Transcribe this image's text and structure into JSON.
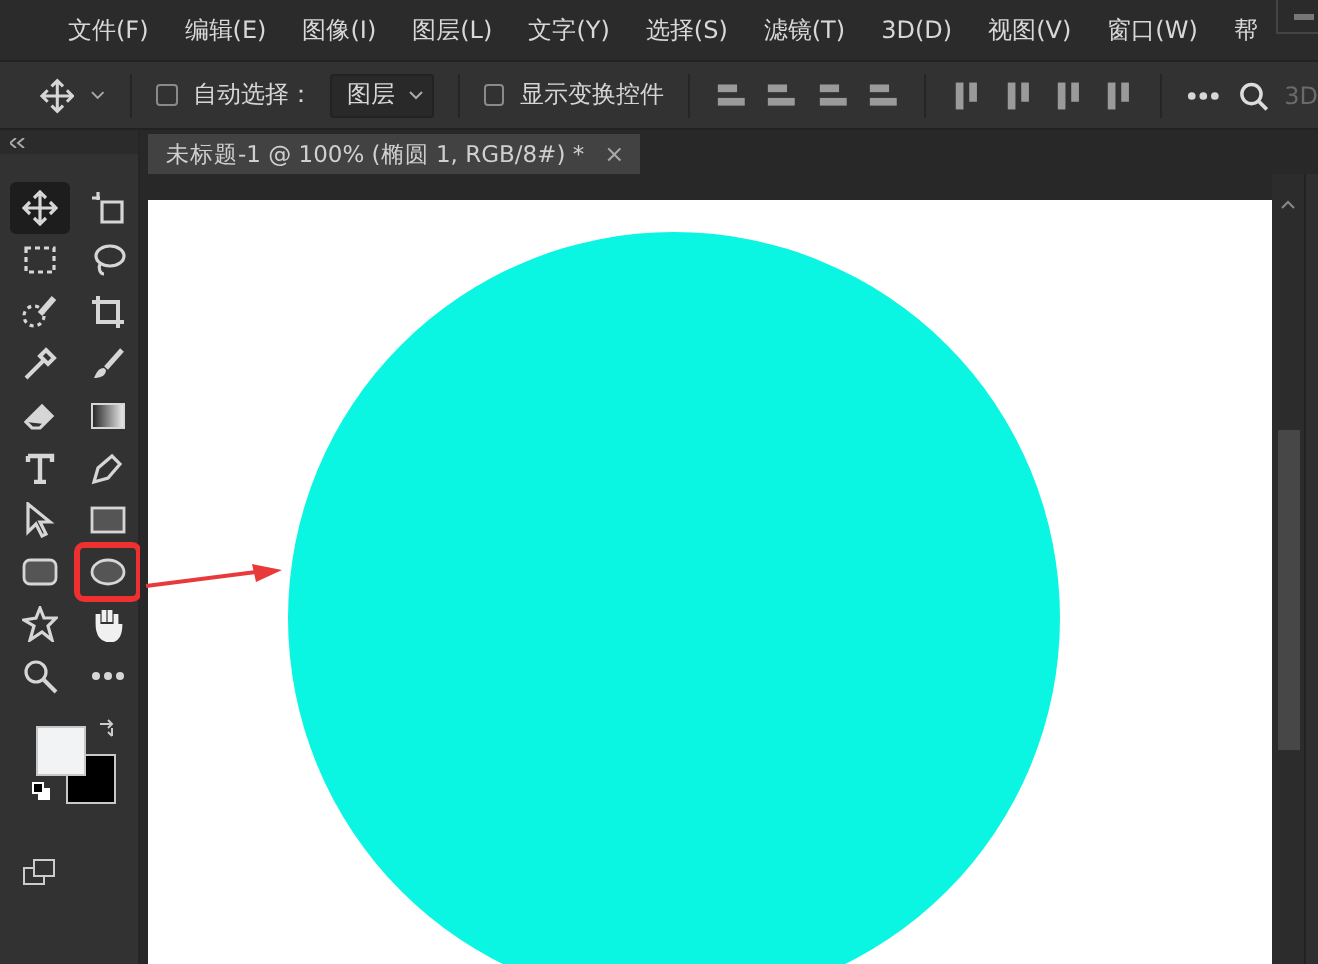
{
  "menu_bar": {
    "items": [
      "文件(F)",
      "编辑(E)",
      "图像(I)",
      "图层(L)",
      "文字(Y)",
      "选择(S)",
      "滤镜(T)",
      "3D(D)",
      "视图(V)",
      "窗口(W)",
      "帮"
    ]
  },
  "options_bar": {
    "auto_select": {
      "label": "自动选择：",
      "checked": false
    },
    "target": {
      "value": "图层"
    },
    "show_transform": {
      "label": "显示变换控件",
      "checked": false
    },
    "mode_label": "3D"
  },
  "document_tab": {
    "title": "未标题-1 @ 100% (椭圆 1, RGB/8#) *",
    "close": "×",
    "selected": true
  },
  "toolbar": {
    "tools": [
      {
        "kind": "move",
        "selected": true,
        "highlighted": false
      },
      {
        "kind": "artboard",
        "selected": false,
        "highlighted": false
      },
      {
        "kind": "marquee",
        "selected": false,
        "highlighted": false
      },
      {
        "kind": "lasso",
        "selected": false,
        "highlighted": false
      },
      {
        "kind": "quickselect",
        "selected": false,
        "highlighted": false
      },
      {
        "kind": "crop",
        "selected": false,
        "highlighted": false
      },
      {
        "kind": "eyedropper",
        "selected": false,
        "highlighted": false
      },
      {
        "kind": "brush",
        "selected": false,
        "highlighted": false
      },
      {
        "kind": "eraser",
        "selected": false,
        "highlighted": false
      },
      {
        "kind": "gradient",
        "selected": false,
        "highlighted": false
      },
      {
        "kind": "type",
        "selected": false,
        "highlighted": false
      },
      {
        "kind": "pen",
        "selected": false,
        "highlighted": false
      },
      {
        "kind": "pointer",
        "selected": false,
        "highlighted": false
      },
      {
        "kind": "rectangle",
        "selected": false,
        "highlighted": false
      },
      {
        "kind": "roundrect",
        "selected": false,
        "highlighted": false
      },
      {
        "kind": "ellipse",
        "selected": false,
        "highlighted": true
      },
      {
        "kind": "puppet",
        "selected": false,
        "highlighted": false
      },
      {
        "kind": "hand",
        "selected": false,
        "highlighted": false
      },
      {
        "kind": "zoom",
        "selected": false,
        "highlighted": false
      },
      {
        "kind": "more",
        "selected": false,
        "highlighted": false
      }
    ]
  }
}
